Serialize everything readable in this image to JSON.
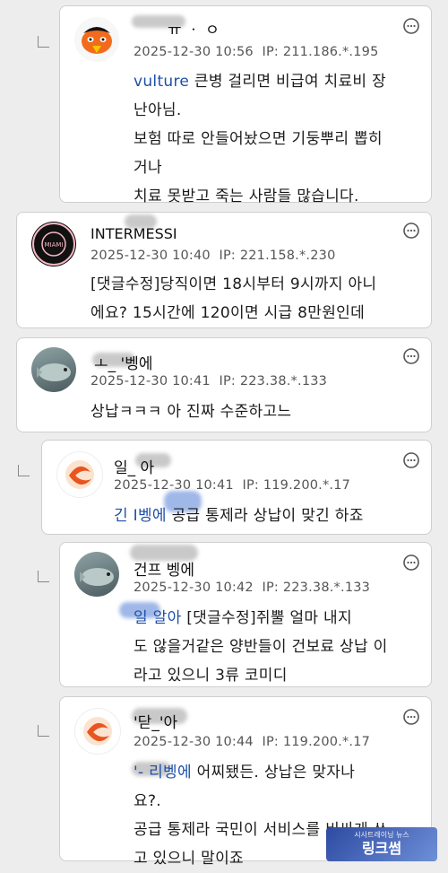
{
  "comments": [
    {
      "name": "ㅠ ㆍ ㅇ",
      "timestamp": "2025-12-30 10:56",
      "ip": "IP: 211.186.*.195",
      "mention": "vulture",
      "lines": [
        "큰병 걸리면 비급여 치료비 장",
        "난아님.",
        "보험 따로 안들어놨으면 기둥뿌리 뽑히",
        "거나",
        "치료 못받고 죽는 사람들 많습니다."
      ]
    },
    {
      "name": "INTERMESSI",
      "timestamp": "2025-12-30 10:40",
      "ip": "IP: 221.158.*.230",
      "lines": [
        "[댓글수정]당직이면 18시부터 9시까지 아니",
        "에요? 15시간에 120이면 시급 8만원인데"
      ]
    },
    {
      "name": "ㅗ_ '벵에",
      "timestamp": "2025-12-30 10:41",
      "ip": "IP: 223.38.*.133",
      "lines": [
        "상납ㅋㅋㅋ 아 진짜 수준하고느"
      ]
    },
    {
      "name": "일_ 아",
      "timestamp": "2025-12-30 10:41",
      "ip": "IP: 119.200.*.17",
      "mention": "긴 I벵에",
      "lines": [
        "공급 통제라 상납이 맞긴 하죠"
      ]
    },
    {
      "name": "건프 벵에",
      "timestamp": "2025-12-30 10:42",
      "ip": "IP: 223.38.*.133",
      "mention": "일 알아",
      "lines": [
        "[댓글수정]쥐뿔 얼마 내지",
        "도 않을거같은 양반들이 건보료 상납 이",
        "라고 있으니 3류 코미디"
      ]
    },
    {
      "name": "'닫_'아",
      "timestamp": "2025-12-30 10:44",
      "ip": "IP: 119.200.*.17",
      "mention": "'- 리벵에",
      "lines": [
        "어찌됐든. 상납은 맞자나",
        "요?.",
        "공급 통제라 국민이 서비스를 비싸게 쓰",
        "고 있으니 말이죠"
      ]
    }
  ],
  "watermark": {
    "top": "시사트레이닝 뉴스",
    "main": "링크썸"
  },
  "colors": {
    "mention": "#1f4fa8",
    "card_bg": "#ffffff",
    "page_bg": "#ededed"
  }
}
